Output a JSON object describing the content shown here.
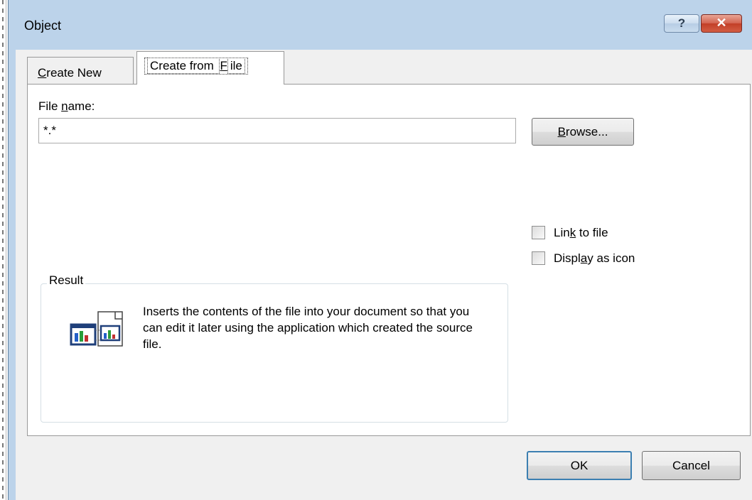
{
  "dialog": {
    "title": "Object",
    "help_glyph": "?",
    "close_glyph": "✕"
  },
  "tabs": [
    {
      "pre": "",
      "key": "C",
      "post": "reate New",
      "active": false
    },
    {
      "pre": "Create from ",
      "key": "F",
      "post": "ile",
      "active": true
    }
  ],
  "file_name": {
    "label_pre": "File ",
    "label_key": "n",
    "label_post": "ame:",
    "value": "*.*"
  },
  "browse": {
    "key": "B",
    "post": "rowse..."
  },
  "options": {
    "link": {
      "pre": "Lin",
      "key": "k",
      "post": " to file",
      "checked": false
    },
    "icon": {
      "pre": "Displ",
      "key": "a",
      "post": "y as icon",
      "checked": false
    }
  },
  "result": {
    "title": "Result",
    "text": "Inserts the contents of the file into your document so that you can edit it later using the application which created the source file."
  },
  "buttons": {
    "ok": "OK",
    "cancel": "Cancel"
  },
  "colors": {
    "title_bar": "#bcd3ea",
    "dialog_bg": "#f0f0f0",
    "close_red": "#c23f27",
    "default_button_border": "#3c7fb1"
  },
  "icons": {
    "help": "question-mark-icon",
    "close": "close-x-icon",
    "result": "embedded-chart-object-icon"
  }
}
